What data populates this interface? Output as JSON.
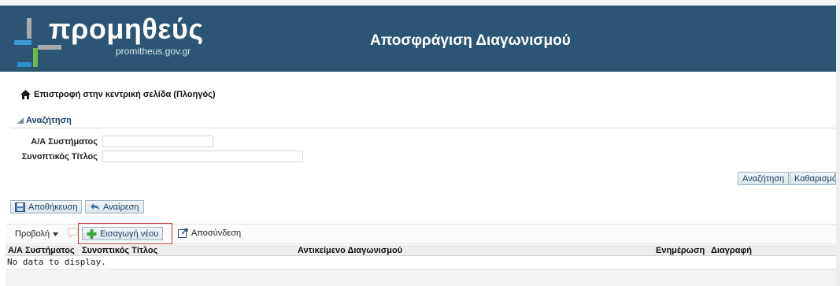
{
  "header": {
    "logo_text": "προμηθεύς",
    "logo_sub": "promitheus.gov.gr",
    "title": "Αποσφράγιση Διαγωνισμού",
    "background": "#2b5572"
  },
  "nav": {
    "back_label": "Επιστροφή στην κεντρική σελίδα (Πλοηγός)"
  },
  "search": {
    "section_label": "Αναζήτηση",
    "field_system_id_label": "Α/Α Συστήματος",
    "field_system_id_value": "",
    "field_title_label": "Συνοπτικός Τίτλος",
    "field_title_value": "",
    "search_button": "Αναζήτηση",
    "clear_button": "Καθαρισμός"
  },
  "actions": {
    "save_label": "Αποθήκευση",
    "undo_label": "Αναίρεση"
  },
  "toolbar": {
    "view_label": "Προβολή",
    "new_label": "Εισαγωγή νέου",
    "detach_label": "Αποσύνδεση"
  },
  "grid": {
    "columns": [
      "Α/Α Συστήματος",
      "Συνοπτικός Τίτλος",
      "Αντικείμενο Διαγωνισμού",
      "Ενημέρωση",
      "Διαγραφή"
    ],
    "empty_text": "No data to display."
  }
}
